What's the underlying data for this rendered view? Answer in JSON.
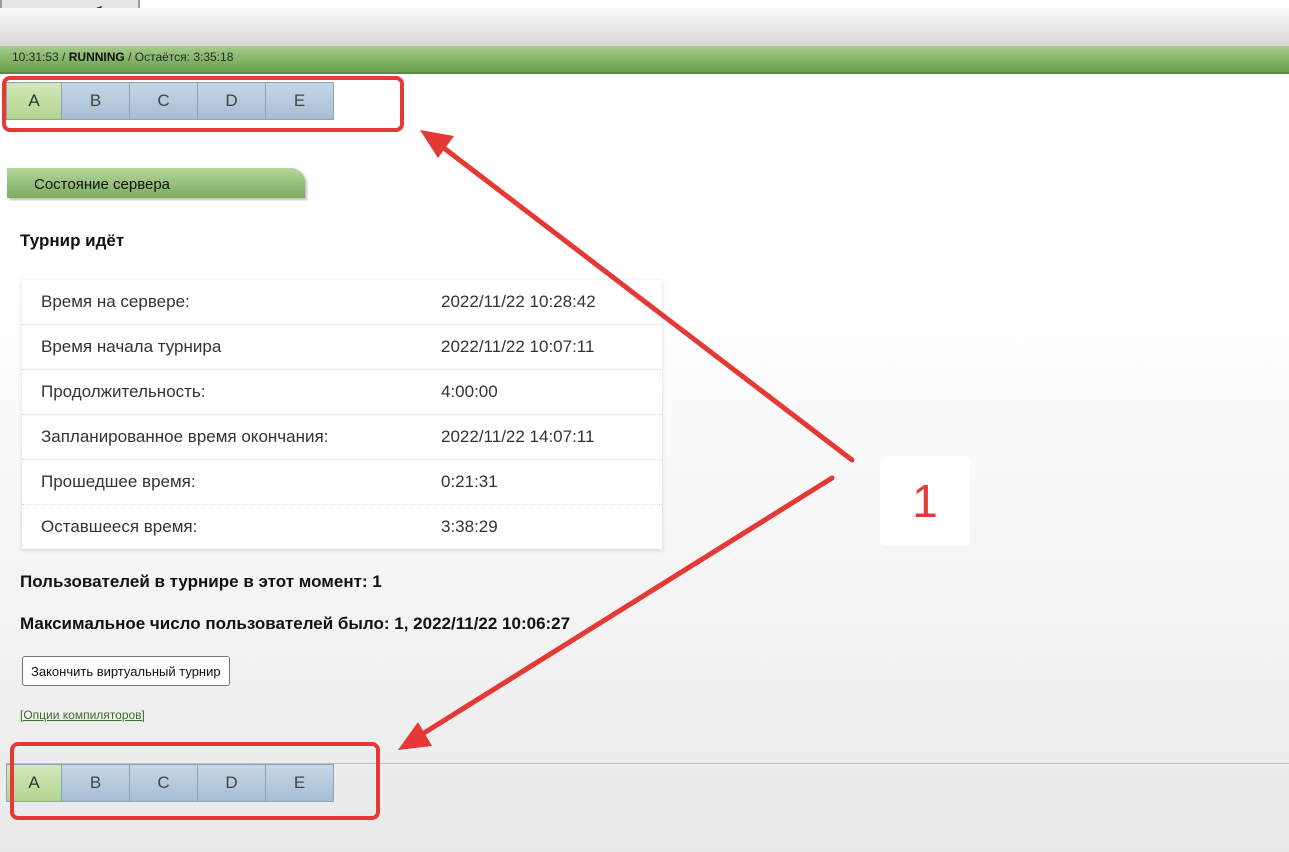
{
  "header": {
    "time": "10:31:53",
    "sep1": " / ",
    "status": "RUNNING",
    "sep2": " / ",
    "remaining_label": "Остаётся: ",
    "remaining": "3:35:18"
  },
  "problem_tabs": [
    "A",
    "B",
    "C",
    "D",
    "E"
  ],
  "active_tab": "A",
  "section": {
    "title": "Состояние сервера"
  },
  "tournament_state": "Турнир идёт",
  "info_rows": [
    {
      "label": "Время на сервере:",
      "value": "2022/11/22 10:28:42"
    },
    {
      "label": "Время начала турнира",
      "value": "2022/11/22 10:07:11"
    },
    {
      "label": "Продолжительность:",
      "value": "4:00:00"
    },
    {
      "label": "Запланированное время окончания:",
      "value": "2022/11/22 14:07:11"
    },
    {
      "label": "Прошедшее время:",
      "value": "0:21:31"
    },
    {
      "label": "Оставшееся время:",
      "value": "3:38:29"
    }
  ],
  "users_now": "Пользователей в турнире в этот момент: 1",
  "max_users": "Максимальное число пользователей было: 1, 2022/11/22 10:06:27",
  "finish_button": "Закончить виртуальный турнир",
  "compiler_options_link": "[Опции компиляторов]",
  "annotation": {
    "number": "1",
    "color": "#e53935"
  }
}
